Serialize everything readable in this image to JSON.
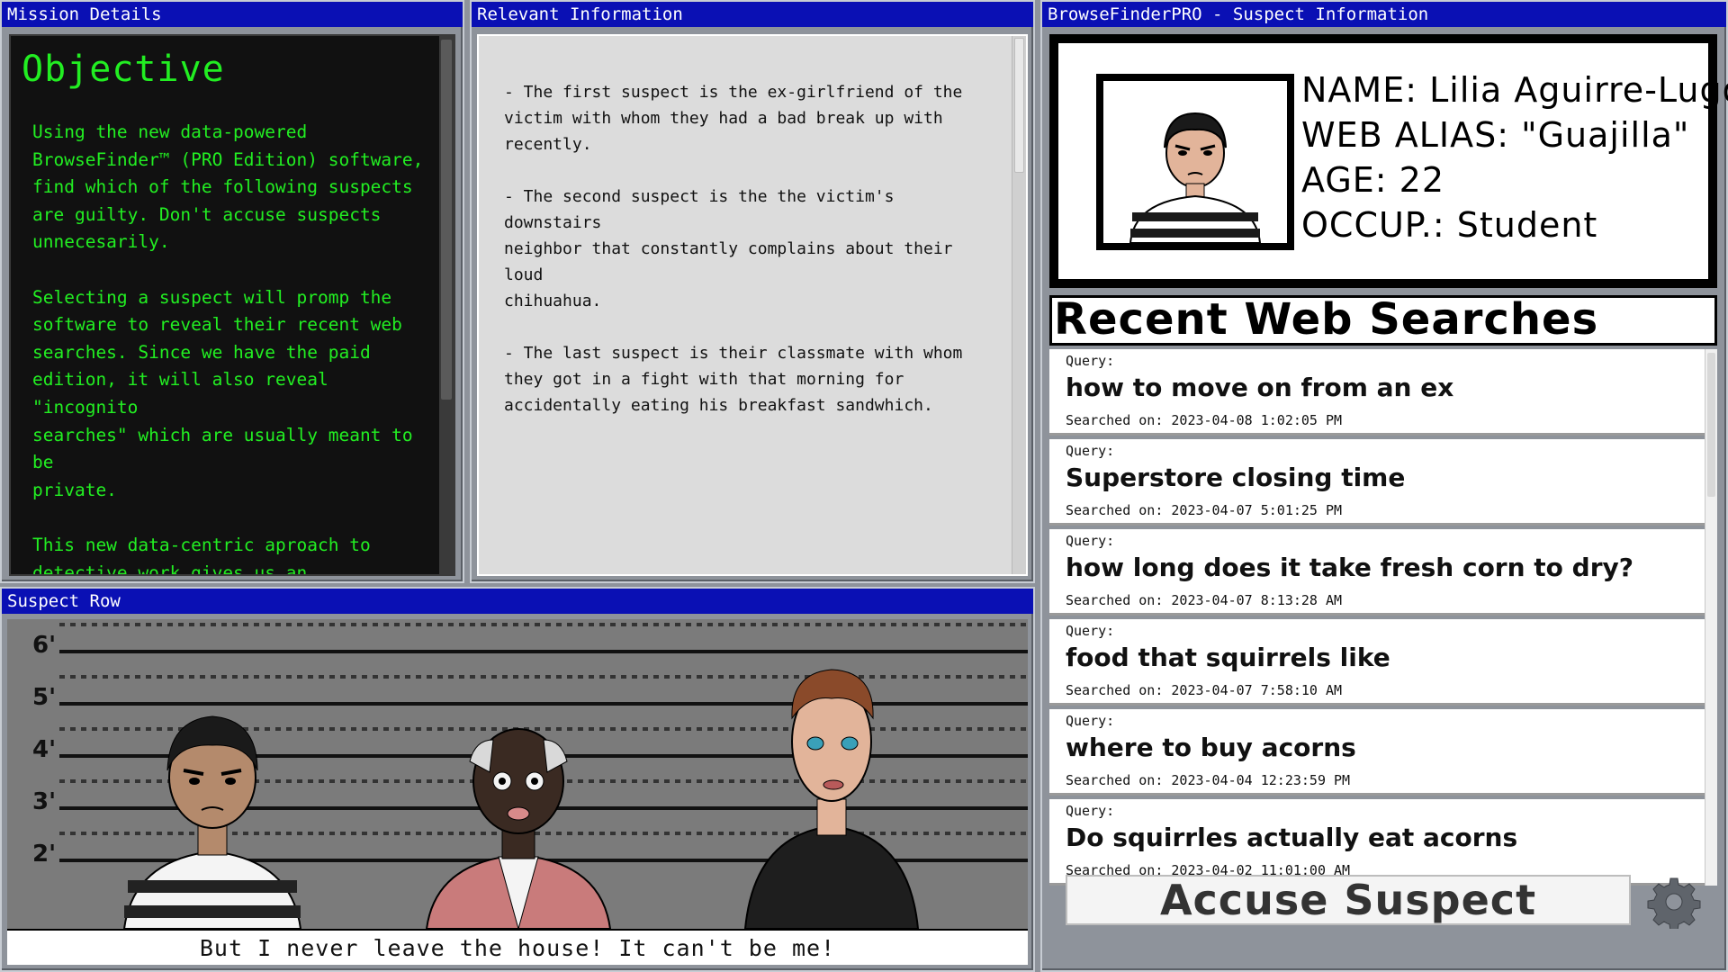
{
  "windows": {
    "mission": {
      "title": "Mission Details"
    },
    "info": {
      "title": "Relevant Information"
    },
    "suspect": {
      "title": "BrowseFinderPRO - Suspect Information"
    },
    "row": {
      "title": "Suspect Row"
    }
  },
  "mission": {
    "heading": "Objective",
    "body": "Using the new data-powered\nBrowseFinder™ (PRO Edition) software,\nfind which of the following suspects\nare guilty. Don't accuse suspects\nunnecesarily.\n\nSelecting a suspect will promp the\nsoftware to reveal their recent web\nsearches. Since we have the paid\nedition, it will also reveal \"incognito\nsearches\" which are usually meant to be\nprivate.\n\nThis new data-centric aproach to\ndetective work gives us an\nunprecedented insight into the lives of\nour suspects. We hope that it will let"
  },
  "info": {
    "body": "- The first suspect is the ex-girlfriend of the\nvictim with whom they had a bad break up with\nrecently.\n\n- The second suspect is the the victim's downstairs\nneighbor that constantly complains about their loud\nchihuahua.\n\n- The last suspect is their classmate with whom\nthey got in a fight with that morning for\naccidentally eating his breakfast sandwhich."
  },
  "suspect_info": {
    "name": "NAME: Lilia Aguirre-Lugo",
    "alias": "WEB ALIAS: \"Guajilla\"",
    "age": "AGE: 22",
    "occupation": "OCCUP.: Student",
    "searches_heading": "Recent Web Searches",
    "query_label": "Query:",
    "searches": [
      {
        "query": "how to move on from an ex",
        "date": "Searched on: 2023-04-08 1:02:05 PM"
      },
      {
        "query": "Superstore closing time",
        "date": "Searched on: 2023-04-07 5:01:25 PM"
      },
      {
        "query": "how long does it take fresh corn to dry?",
        "date": "Searched on: 2023-04-07 8:13:28 AM"
      },
      {
        "query": "food that squirrels like",
        "date": "Searched on: 2023-04-07 7:58:10 AM"
      },
      {
        "query": "where to buy acorns",
        "date": "Searched on: 2023-04-04 12:23:59 PM"
      },
      {
        "query": "Do squirrles actually eat acorns",
        "date": "Searched on: 2023-04-02 11:01:00 AM"
      },
      {
        "query": "",
        "date": ""
      }
    ],
    "accuse_label": "Accuse Suspect",
    "settings_icon": "gear-icon"
  },
  "row": {
    "heights": [
      "6'",
      "5'",
      "4'",
      "3'",
      "2'"
    ],
    "caption": "But I never leave the house! It can't be me!"
  }
}
